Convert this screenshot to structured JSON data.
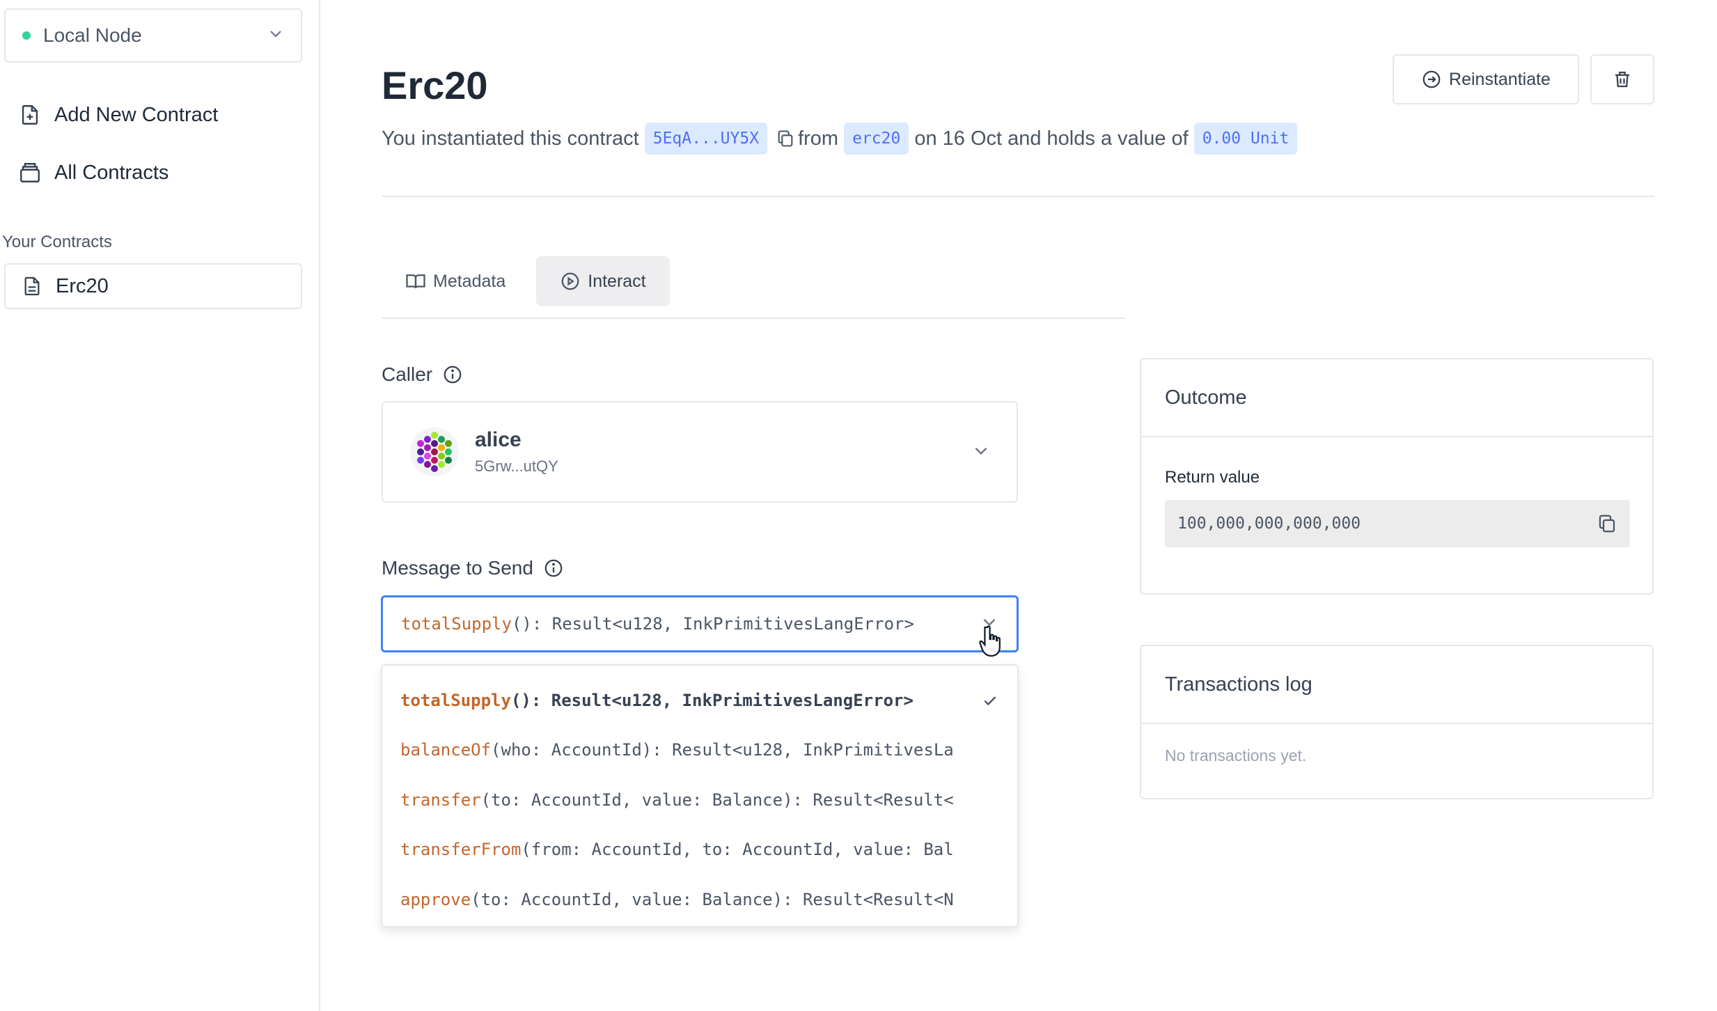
{
  "sidebar": {
    "node": {
      "label": "Local Node",
      "status_color": "#34d399"
    },
    "nav": [
      {
        "label": "Add New Contract",
        "icon": "file-plus-icon"
      },
      {
        "label": "All Contracts",
        "icon": "briefcase-icon"
      }
    ],
    "contracts_heading": "Your Contracts",
    "contracts": [
      {
        "label": "Erc20",
        "icon": "file-text-icon"
      }
    ]
  },
  "header": {
    "title": "Erc20",
    "desc_prefix": "You instantiated this contract",
    "address": "5EqA...UY5X",
    "desc_from": "from",
    "code_name": "erc20",
    "desc_date": "on 16 Oct and holds a value of",
    "value": "0.00 Unit",
    "reinstantiate_label": "Reinstantiate"
  },
  "tabs": [
    {
      "label": "Metadata",
      "icon": "book-icon",
      "active": false
    },
    {
      "label": "Interact",
      "icon": "play-circle-icon",
      "active": true
    }
  ],
  "caller": {
    "label": "Caller",
    "name": "alice",
    "address": "5Grw...utQY"
  },
  "message": {
    "label": "Message to Send",
    "selected": {
      "fn": "totalSupply",
      "sig": "(): Result<u128, InkPrimitivesLangError>"
    },
    "options": [
      {
        "fn": "totalSupply",
        "sig": "(): Result<u128, InkPrimitivesLangError>",
        "selected": true
      },
      {
        "fn": "balanceOf",
        "sig": "(who: AccountId): Result<u128, InkPrimitivesLa",
        "selected": false
      },
      {
        "fn": "transfer",
        "sig": "(to: AccountId, value: Balance): Result<Result<",
        "selected": false
      },
      {
        "fn": "transferFrom",
        "sig": "(from: AccountId, to: AccountId, value: Bal",
        "selected": false
      },
      {
        "fn": "approve",
        "sig": "(to: AccountId, value: Balance): Result<Result<N",
        "selected": false
      }
    ]
  },
  "outcome": {
    "title": "Outcome",
    "return_label": "Return value",
    "return_value": "100,000,000,000,000"
  },
  "txlog": {
    "title": "Transactions log",
    "empty": "No transactions yet."
  },
  "colors": {
    "accent": "#3b82f6",
    "fn_name": "#c2662d",
    "chip_bg": "#dbeafe",
    "chip_text": "#4f6ef7"
  }
}
